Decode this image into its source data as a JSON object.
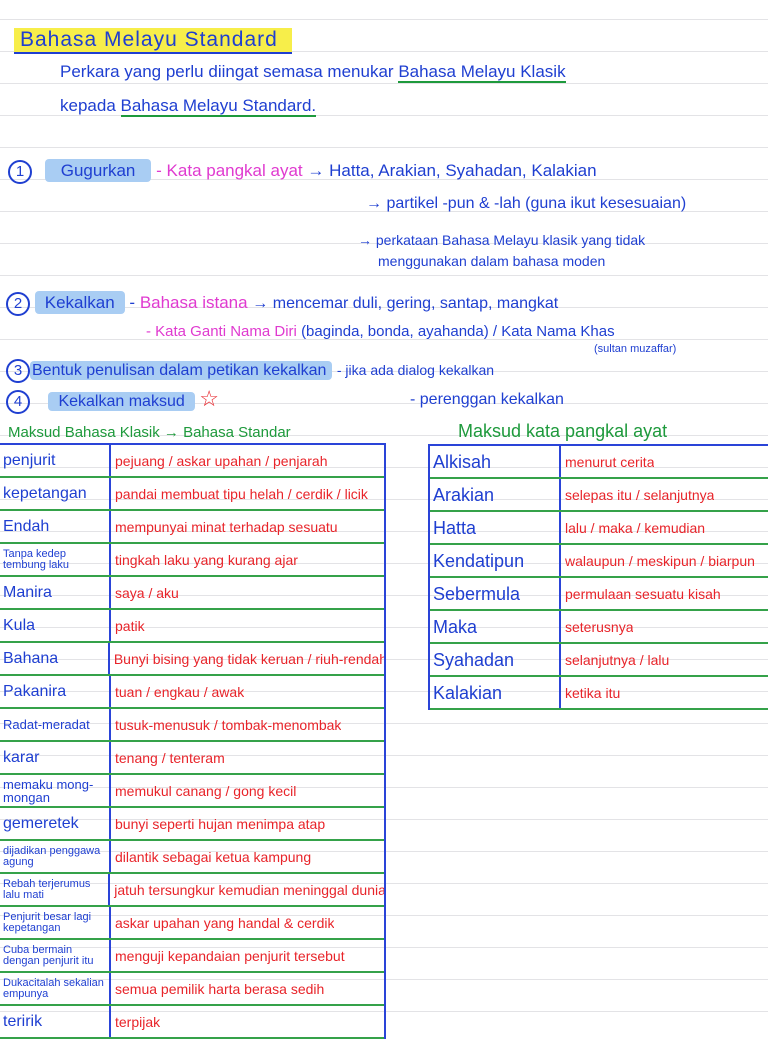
{
  "title": "Bahasa Melayu Standard",
  "intro_1": "Perkara yang perlu diingat semasa menukar",
  "intro_link": "Bahasa Melayu Klasik",
  "intro_2": "kepada",
  "intro_link2": "Bahasa Melayu Standard.",
  "points": [
    {
      "num": "1",
      "label": "Gugurkan",
      "dash": "-",
      "pink": "Kata pangkal ayat",
      "arrow": "→ Hatta, Arakian, Syahadan, Kalakian",
      "line2": "→ partikel -pun & -lah (guna ikut kesesuaian)",
      "line3": "→ perkataan Bahasa Melayu klasik yang tidak",
      "line4": "menggunakan dalam bahasa moden"
    },
    {
      "num": "2",
      "label": "Kekalkan",
      "dash": "-",
      "pink": "Bahasa istana",
      "arrow": "→ mencemar duli, gering, santap, mangkat",
      "pink2": "- Kata Ganti Nama Diri",
      "line2": "(baginda, bonda, ayahanda) / Kata Nama Khas",
      "note": "(sultan muzaffar)"
    },
    {
      "num": "3",
      "label": "Bentuk penulisan dalam petikan kekalkan",
      "rest": "- jika ada dialog kekalkan"
    },
    {
      "num": "4",
      "label": "Kekalkan maksud",
      "star": "☆",
      "rest": "- perenggan kekalkan"
    }
  ],
  "left_table": {
    "heading": "Maksud Bahasa Klasik → Bahasa Standar",
    "rows": [
      {
        "k": "penjurit",
        "v": "pejuang / askar upahan / penjarah"
      },
      {
        "k": "kepetangan",
        "v": "pandai membuat tipu helah / cerdik / licik"
      },
      {
        "k": "Endah",
        "v": "mempunyai minat terhadap sesuatu"
      },
      {
        "k": "Tanpa kedep tembung laku",
        "v": "tingkah laku yang kurang ajar"
      },
      {
        "k": "Manira",
        "v": "saya / aku"
      },
      {
        "k": "Kula",
        "v": "patik"
      },
      {
        "k": "Bahana",
        "v": "Bunyi bising yang tidak keruan / riuh-rendah"
      },
      {
        "k": "Pakanira",
        "v": "tuan / engkau / awak"
      },
      {
        "k": "Radat-meradat",
        "v": "tusuk-menusuk / tombak-menombak"
      },
      {
        "k": "karar",
        "v": "tenang / tenteram"
      },
      {
        "k": "memaku mong-mongan",
        "v": "memukul canang / gong kecil"
      },
      {
        "k": "gemeretek",
        "v": "bunyi seperti hujan menimpa atap"
      },
      {
        "k": "dijadikan penggawa agung",
        "v": "dilantik sebagai ketua kampung"
      },
      {
        "k": "Rebah terjerumus lalu mati",
        "v": "jatuh tersungkur kemudian meninggal dunia"
      },
      {
        "k": "Penjurit besar lagi kepetangan",
        "v": "askar upahan yang handal & cerdik"
      },
      {
        "k": "Cuba bermain dengan penjurit itu",
        "v": "menguji kepandaian penjurit tersebut"
      },
      {
        "k": "Dukacitalah sekalian empunya",
        "v": "semua pemilik harta berasa sedih"
      },
      {
        "k": "teririk",
        "v": "terpijak"
      }
    ]
  },
  "right_table": {
    "heading": "Maksud kata pangkal ayat",
    "rows": [
      {
        "k": "Alkisah",
        "v": "menurut cerita"
      },
      {
        "k": "Arakian",
        "v": "selepas itu / selanjutnya"
      },
      {
        "k": "Hatta",
        "v": "lalu / maka / kemudian"
      },
      {
        "k": "Kendatipun",
        "v": "walaupun / meskipun / biarpun"
      },
      {
        "k": "Sebermula",
        "v": "permulaan sesuatu kisah"
      },
      {
        "k": "Maka",
        "v": "seterusnya"
      },
      {
        "k": "Syahadan",
        "v": "selanjutnya / lalu"
      },
      {
        "k": "Kalakian",
        "v": "ketika itu"
      }
    ]
  }
}
